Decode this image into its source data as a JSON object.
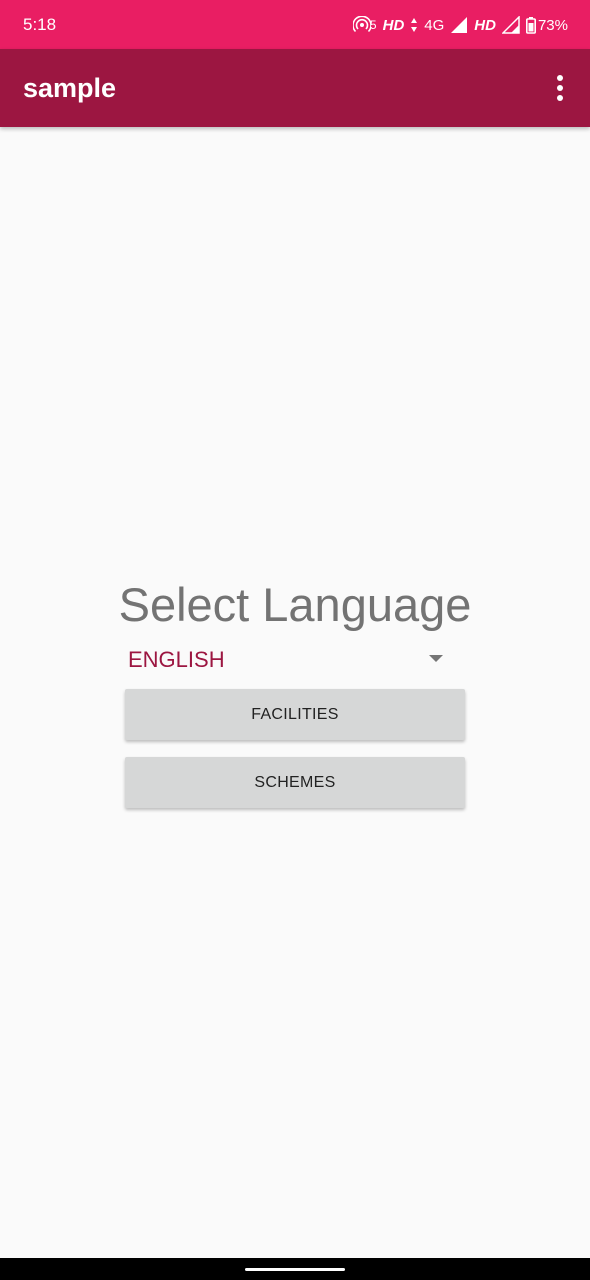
{
  "status_bar": {
    "time": "5:18",
    "hotspot_count": "5",
    "hd1": "HD",
    "network": "4G",
    "hd2": "HD",
    "battery": "73%"
  },
  "app_bar": {
    "title": "sample",
    "menu_icon": "more-vert-icon"
  },
  "main": {
    "heading": "Select Language",
    "language_spinner": {
      "selected": "ENGLISH"
    },
    "buttons": {
      "facilities": "FACILITIES",
      "schemes": "SCHEMES"
    }
  },
  "colors": {
    "status_bar": "#e91e63",
    "app_bar": "#9c1641",
    "accent": "#9c1641",
    "button_bg": "#d6d7d7",
    "background": "#fafafa"
  }
}
